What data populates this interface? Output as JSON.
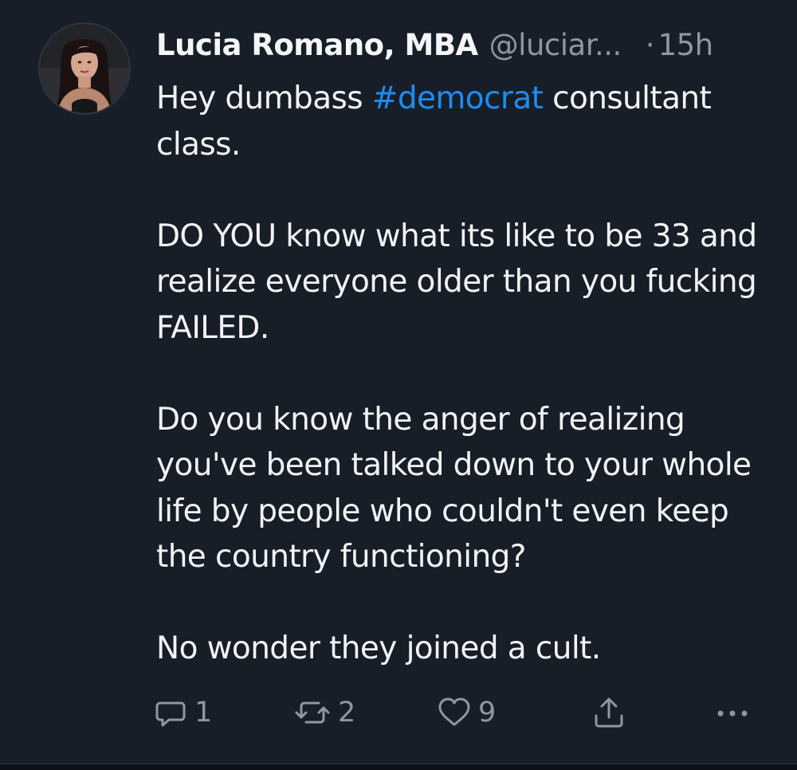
{
  "post": {
    "author": {
      "display_name": "Lucia Romano, MBA",
      "handle": "@luciar...",
      "separator": "·",
      "time": "15h"
    },
    "body": {
      "p1_before_tag": "Hey dumbass ",
      "hashtag": "#democrat",
      "p1_after_tag": " consultant class.",
      "p2": "DO YOU know what its like to be 33 and realize everyone older than you fucking FAILED.",
      "p3": "Do you know the anger of realizing you've been talked down to your whole life by people who couldn't even keep the country functioning?",
      "p4": "No wonder they joined a cult."
    },
    "actions": {
      "reply": {
        "icon": "reply-icon",
        "count": "1"
      },
      "repost": {
        "icon": "repost-icon",
        "count": "2"
      },
      "like": {
        "icon": "heart-icon",
        "count": "9"
      },
      "share": {
        "icon": "share-icon"
      },
      "more": {
        "icon": "more-icon"
      }
    }
  },
  "colors": {
    "background": "#171e28",
    "text": "#f1f3f5",
    "muted": "#8b98a5",
    "hashtag": "#1d8cf0"
  }
}
